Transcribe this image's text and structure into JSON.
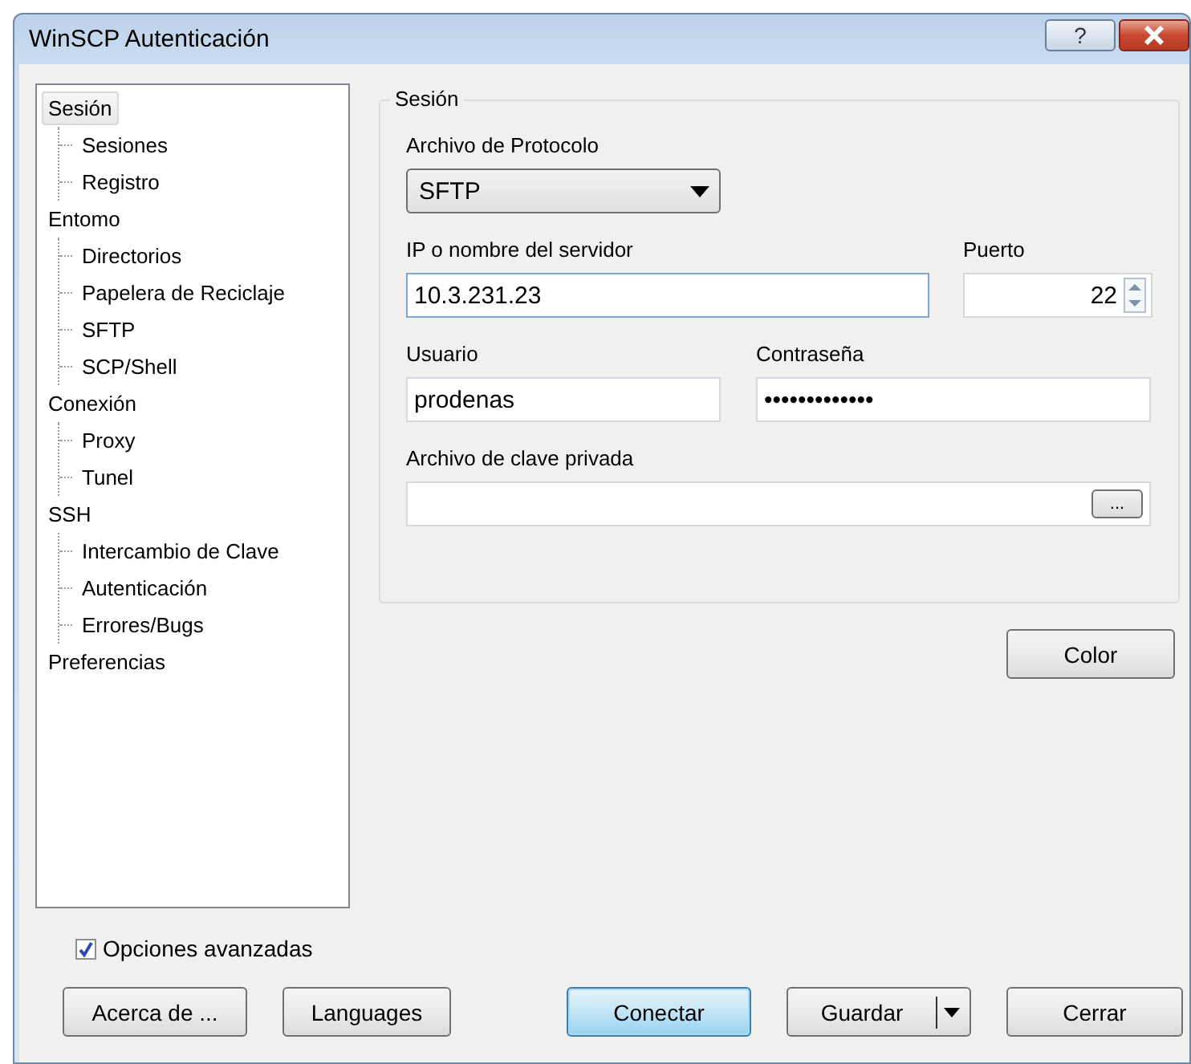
{
  "window": {
    "title": "WinSCP Autenticación",
    "help_label": "?"
  },
  "tree": [
    {
      "label": "Sesión",
      "selected": true,
      "children": [
        {
          "label": "Sesiones",
          "selected": false
        },
        {
          "label": "Registro",
          "selected": false
        }
      ]
    },
    {
      "label": "Entomo",
      "selected": false,
      "children": [
        {
          "label": "Directorios",
          "selected": false
        },
        {
          "label": "Papelera de Reciclaje",
          "selected": false
        },
        {
          "label": "SFTP",
          "selected": false
        },
        {
          "label": "SCP/Shell",
          "selected": false
        }
      ]
    },
    {
      "label": "Conexión",
      "selected": false,
      "children": [
        {
          "label": "Proxy",
          "selected": false
        },
        {
          "label": "Tunel",
          "selected": false
        }
      ]
    },
    {
      "label": "SSH",
      "selected": false,
      "children": [
        {
          "label": "Intercambio de Clave",
          "selected": false
        },
        {
          "label": "Autenticación",
          "selected": false
        },
        {
          "label": "Errores/Bugs",
          "selected": false
        }
      ]
    },
    {
      "label": "Preferencias",
      "selected": false
    }
  ],
  "session": {
    "title": "Sesión",
    "protocol": {
      "label": "Archivo de Protocolo",
      "value": "SFTP"
    },
    "host": {
      "label": "IP o nombre del servidor",
      "value": "10.3.231.23",
      "focused": true
    },
    "port": {
      "label": "Puerto",
      "value": "22"
    },
    "user": {
      "label": "Usuario",
      "value": "prodenas"
    },
    "password": {
      "label": "Contraseña",
      "value": "•••••••••••••"
    },
    "key_file": {
      "label": "Archivo de clave privada",
      "browse_label": "..."
    }
  },
  "color_button": "Color",
  "advanced": {
    "label": "Opciones avanzadas",
    "checked": true
  },
  "buttons": [
    {
      "label": "Acerca de ...",
      "kind": "normal"
    },
    {
      "label": "Languages",
      "kind": "normal"
    },
    {
      "label": "Conectar",
      "kind": "default"
    },
    {
      "label": "Guardar",
      "kind": "split"
    },
    {
      "label": "Cerrar",
      "kind": "normal"
    }
  ]
}
